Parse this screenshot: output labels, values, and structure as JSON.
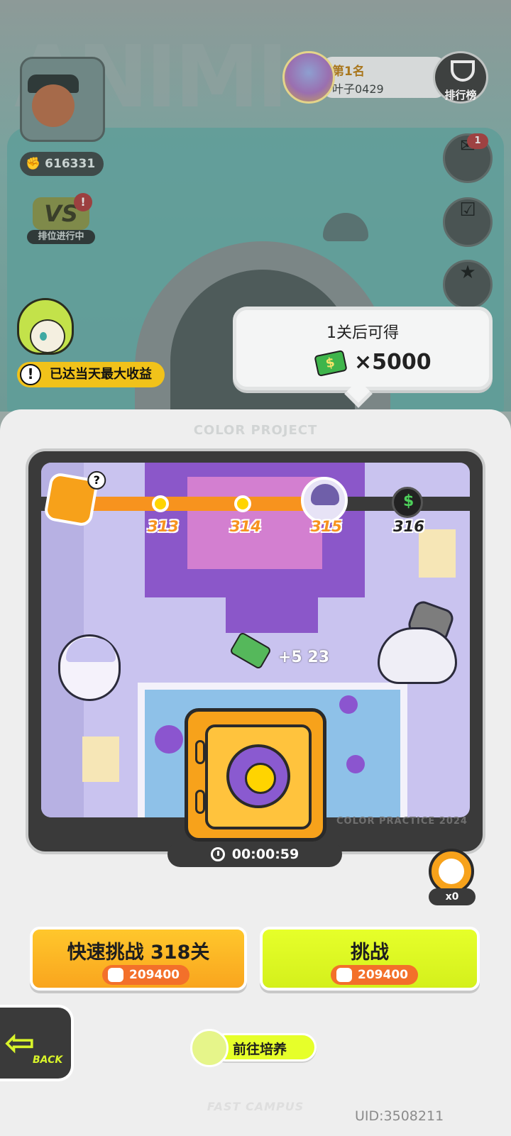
{
  "header": {
    "power_value": "616331",
    "rank_button_label": "排位进行中",
    "rank_alert": "!",
    "leaderboard": {
      "rank_text": "第1名",
      "player_name": "叶子0429",
      "button_label": "排行榜"
    },
    "mail_badge": "1"
  },
  "notice": {
    "max_earnings": "已达当天最大收益",
    "warn_symbol": "!"
  },
  "reward_bubble": {
    "title": "1关后可得",
    "amount": "×5000"
  },
  "panel": {
    "project_title": "COLOR PROJECT",
    "watermark": "COLOR PRACTICE 2024",
    "levels": [
      "313",
      "314",
      "315",
      "316"
    ],
    "chest_help": "?",
    "paint_pickup": "+5 23",
    "timer": "00:00:59",
    "alarm_count": "x0"
  },
  "buttons": {
    "quick_challenge": "快速挑战 318关",
    "quick_cost": "209400",
    "challenge": "挑战",
    "challenge_cost": "209400",
    "train": "前往培养",
    "back": "BACK"
  },
  "footer": {
    "campus": "FAST CAMPUS",
    "uid": "UID:3508211"
  },
  "colors": {
    "accent_orange": "#f7931e",
    "accent_lime": "#e6ff2a",
    "panel_bg": "#eeeeee"
  }
}
